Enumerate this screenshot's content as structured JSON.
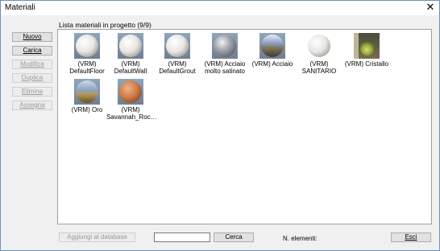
{
  "window": {
    "title": "Materiali",
    "close_glyph": "✕"
  },
  "buttons": {
    "nuovo": "Nuovo",
    "carica": "Carica",
    "modifica": "Modifica",
    "duplica": "Duplica",
    "elimina": "Elimina",
    "assegna": "Assegna"
  },
  "list": {
    "label": "Lista materiali in progetto (9/9)",
    "items": [
      {
        "caption": "(VRM)\nDefaultFloor",
        "icon": "white-sphere-icon"
      },
      {
        "caption": "(VRM) DefaultWall",
        "icon": "white-sphere-icon"
      },
      {
        "caption": "(VRM)\nDefaultGrout",
        "icon": "white-sphere-icon"
      },
      {
        "caption": "(VRM) Acciaio\nmolto satinato",
        "icon": "steel-sphere-icon"
      },
      {
        "caption": "(VRM) Acciaio",
        "icon": "steel-sphere-icon"
      },
      {
        "caption": "(VRM)\nSANITARIO",
        "icon": "white-sphere-icon"
      },
      {
        "caption": "(VRM) Cristallo",
        "icon": "glass-sphere-icon"
      },
      {
        "caption": "(VRM) Oro",
        "icon": "gold-sphere-icon"
      },
      {
        "caption": "(VRM)\nSavannah_Roc…",
        "icon": "terracotta-sphere-icon"
      }
    ]
  },
  "footer": {
    "add_to_db": "Aggiungi al database",
    "search_value": "",
    "search_button": "Cerca",
    "count_label": "N. elementi:",
    "exit_button": "Esci"
  }
}
